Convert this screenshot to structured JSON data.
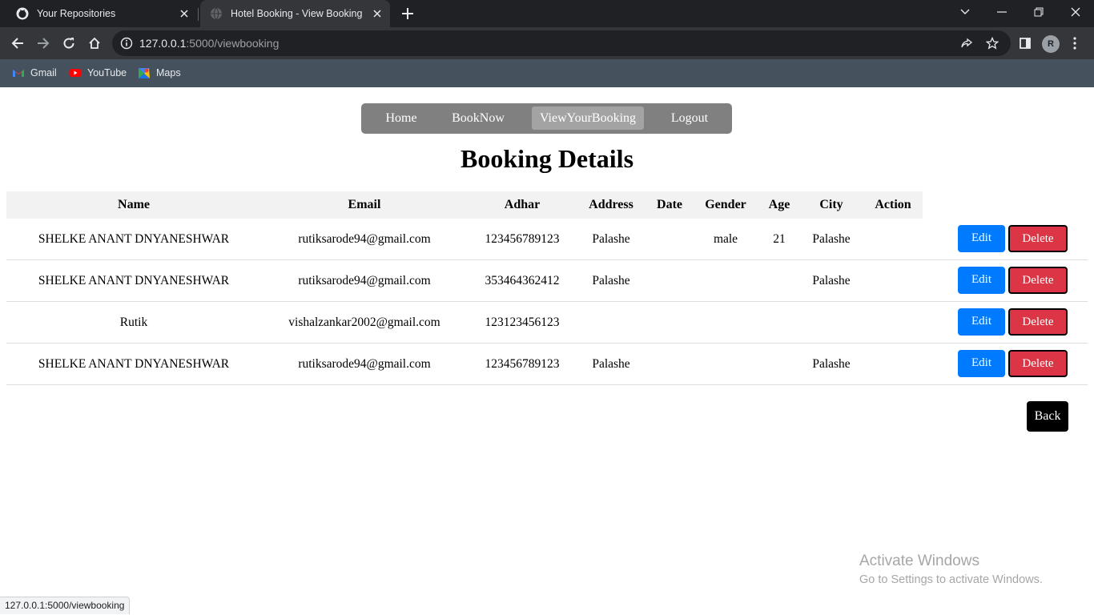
{
  "browser": {
    "tabs": [
      {
        "title": "Your Repositories",
        "active": false
      },
      {
        "title": "Hotel Booking - View Booking",
        "active": true
      }
    ],
    "url_host": "127.0.0.1",
    "url_rest": ":5000/viewbooking",
    "profile_initial": "R",
    "bookmarks": [
      "Gmail",
      "YouTube",
      "Maps"
    ]
  },
  "nav": {
    "links": [
      "Home",
      "BookNow",
      "ViewYourBooking",
      "Logout"
    ],
    "active_link": "ViewYourBooking"
  },
  "page": {
    "title": "Booking Details",
    "back_label": "Back"
  },
  "table": {
    "headers": [
      "Name",
      "Email",
      "Adhar",
      "Address",
      "Date",
      "Gender",
      "Age",
      "City",
      "Action"
    ],
    "edit_label": "Edit",
    "delete_label": "Delete",
    "rows": [
      {
        "name": "SHELKE ANANT DNYANESHWAR",
        "email": "rutiksarode94@gmail.com",
        "adhar": "123456789123",
        "address": "Palashe",
        "date": "",
        "gender": "male",
        "age": "21",
        "city": "Palashe"
      },
      {
        "name": "SHELKE ANANT DNYANESHWAR",
        "email": "rutiksarode94@gmail.com",
        "adhar": "353464362412",
        "address": "Palashe",
        "date": "",
        "gender": "",
        "age": "",
        "city": "Palashe"
      },
      {
        "name": "Rutik",
        "email": "vishalzankar2002@gmail.com",
        "adhar": "123123456123",
        "address": "",
        "date": "",
        "gender": "",
        "age": "",
        "city": ""
      },
      {
        "name": "SHELKE ANANT DNYANESHWAR",
        "email": "rutiksarode94@gmail.com",
        "adhar": "123456789123",
        "address": "Palashe",
        "date": "",
        "gender": "",
        "age": "",
        "city": "Palashe"
      }
    ]
  },
  "os": {
    "watermark_title": "Activate Windows",
    "watermark_sub": "Go to Settings to activate Windows."
  },
  "status_bar_url": "127.0.0.1:5000/viewbooking",
  "colors": {
    "edit_button": "#007bff",
    "delete_button": "#dc3545",
    "navbar": "#808080",
    "navbar_active": "#a3a3a3",
    "back_button": "#000000"
  }
}
